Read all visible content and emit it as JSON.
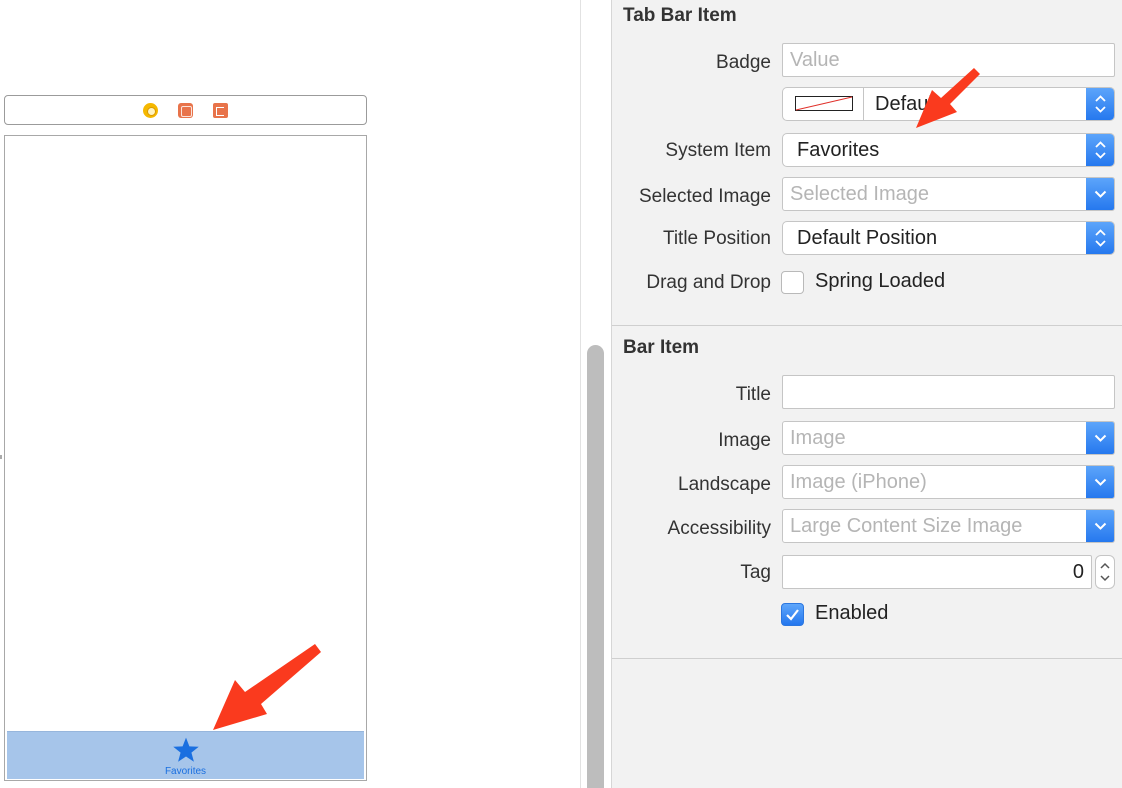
{
  "canvas": {
    "tab_bar_item_title": "Favorites"
  },
  "inspector": {
    "tab_bar_item": {
      "section_title": "Tab Bar Item",
      "badge": {
        "label": "Badge",
        "placeholder": "Value"
      },
      "badge_color": {
        "value": "Default"
      },
      "system_item": {
        "label": "System Item",
        "value": "Favorites"
      },
      "selected_image": {
        "label": "Selected Image",
        "placeholder": "Selected Image"
      },
      "title_position": {
        "label": "Title Position",
        "value": "Default Position"
      },
      "drag_and_drop": {
        "label": "Drag and Drop",
        "checkbox_label": "Spring Loaded",
        "checked": false
      }
    },
    "bar_item": {
      "section_title": "Bar Item",
      "title": {
        "label": "Title",
        "value": ""
      },
      "image": {
        "label": "Image",
        "placeholder": "Image"
      },
      "landscape": {
        "label": "Landscape",
        "placeholder": "Image (iPhone)"
      },
      "accessibility": {
        "label": "Accessibility",
        "placeholder": "Large Content Size Image"
      },
      "tag": {
        "label": "Tag",
        "value": "0"
      },
      "enabled": {
        "label": "Enabled",
        "checked": true
      }
    }
  },
  "colors": {
    "accent_blue": "#2477ee",
    "tab_bar_background": "#a6c5ea",
    "annotation_arrow": "#fa3a1e"
  },
  "icons": {
    "dock": [
      "view-controller-icon",
      "first-responder-icon",
      "exit-icon"
    ],
    "tab": "star-icon"
  }
}
